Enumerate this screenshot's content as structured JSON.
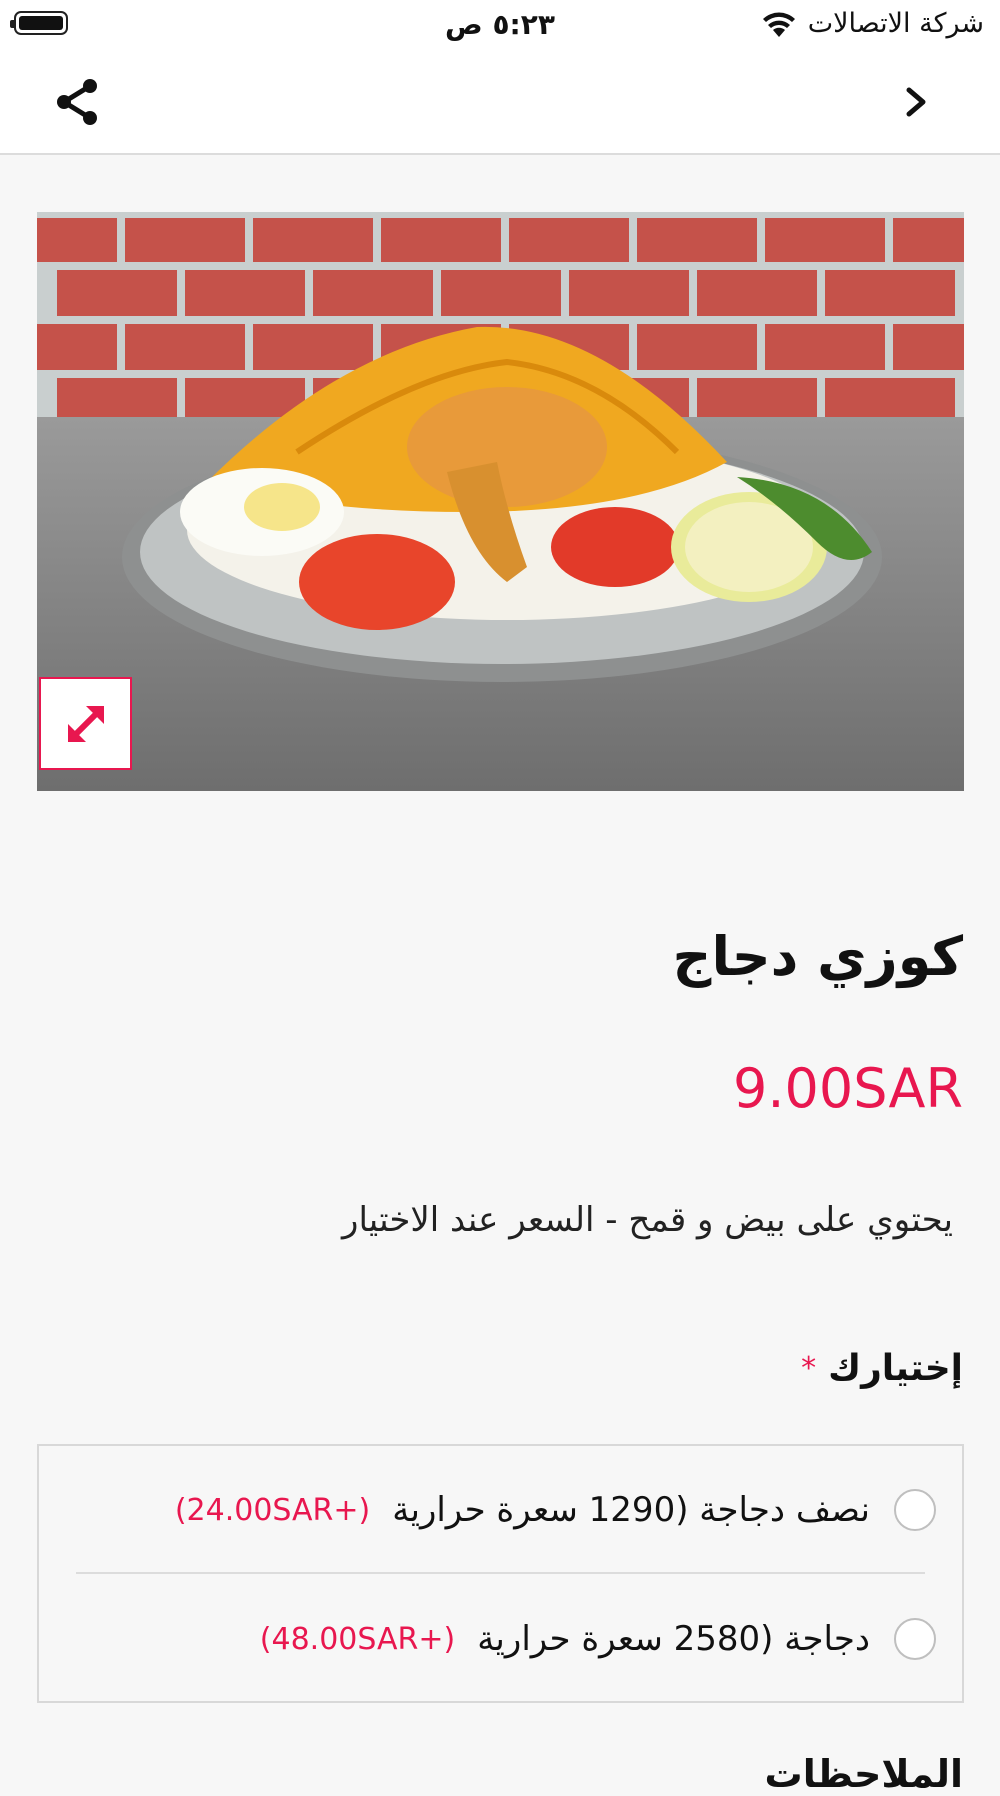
{
  "status_bar": {
    "carrier": "شركة الاتصالات",
    "time": "٥:٢٣ ص"
  },
  "nav": {
    "share_icon": "share-icon",
    "back_icon": "chevron-right-icon"
  },
  "product": {
    "image_alt": "image of chicken kabsa on a plate",
    "expand_icon": "expand-icon",
    "title": "كوزي دجاج",
    "price": "9.00SAR",
    "description": "يحتوي على بيض و قمح - السعر عند الاختيار"
  },
  "choice": {
    "heading": "إختيارك",
    "required_marker": "*",
    "options": [
      {
        "label": "نصف دجاجة (1290 سعرة حرارية",
        "price": "(+24.00SAR)"
      },
      {
        "label": "دجاجة (2580 سعرة حرارية",
        "price": "(+48.00SAR)"
      }
    ]
  },
  "notes": {
    "heading": "الملاحظات"
  },
  "colors": {
    "accent": "#e8174f",
    "background": "#f7f7f7"
  }
}
